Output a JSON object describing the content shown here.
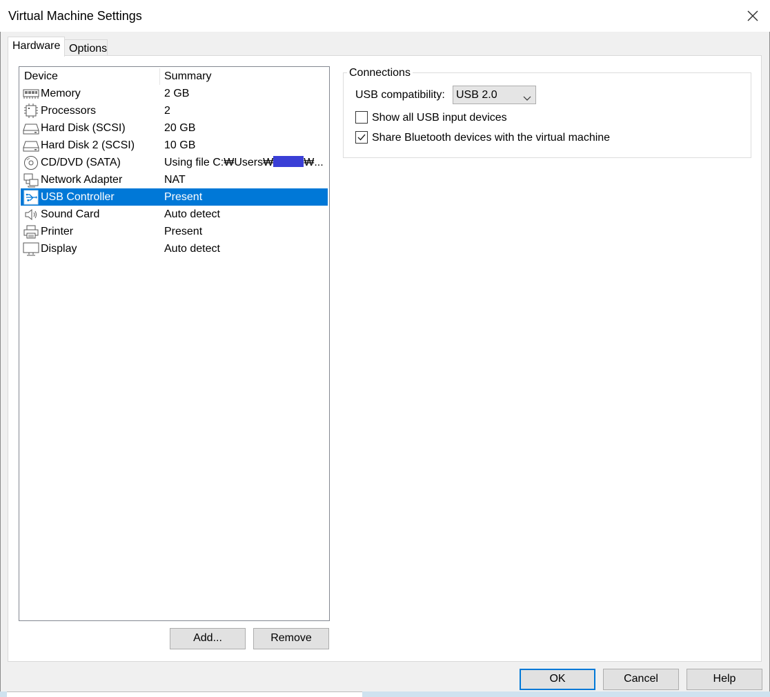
{
  "window": {
    "title": "Virtual Machine Settings"
  },
  "tabs": [
    {
      "label": "Hardware",
      "active": true
    },
    {
      "label": "Options",
      "active": false
    }
  ],
  "device_list": {
    "headers": {
      "device": "Device",
      "summary": "Summary"
    },
    "rows": [
      {
        "icon": "memory-icon",
        "device": "Memory",
        "summary": "2 GB"
      },
      {
        "icon": "processor-icon",
        "device": "Processors",
        "summary": "2"
      },
      {
        "icon": "hard-disk-icon",
        "device": "Hard Disk (SCSI)",
        "summary": "20 GB"
      },
      {
        "icon": "hard-disk-icon",
        "device": "Hard Disk 2 (SCSI)",
        "summary": "10 GB"
      },
      {
        "icon": "cd-dvd-icon",
        "device": "CD/DVD (SATA)",
        "summary_prefix": "Using file C:₩Users₩",
        "summary_suffix": "₩..."
      },
      {
        "icon": "network-adapter-icon",
        "device": "Network Adapter",
        "summary": "NAT"
      },
      {
        "icon": "usb-icon",
        "device": "USB Controller",
        "summary": "Present",
        "selected": true
      },
      {
        "icon": "sound-card-icon",
        "device": "Sound Card",
        "summary": "Auto detect"
      },
      {
        "icon": "printer-icon",
        "device": "Printer",
        "summary": "Present"
      },
      {
        "icon": "display-icon",
        "device": "Display",
        "summary": "Auto detect"
      }
    ]
  },
  "list_buttons": {
    "add": "Add...",
    "remove": "Remove"
  },
  "connections": {
    "group_label": "Connections",
    "usb_compat_label": "USB compatibility:",
    "usb_compat_value": "USB 2.0",
    "show_all_label": "Show all USB input devices",
    "show_all_checked": false,
    "share_bt_label": "Share Bluetooth devices with the virtual machine",
    "share_bt_checked": true
  },
  "dialog_buttons": {
    "ok": "OK",
    "cancel": "Cancel",
    "help": "Help"
  },
  "colors": {
    "selection": "#0078d7",
    "redaction": "#3a3fd6"
  }
}
